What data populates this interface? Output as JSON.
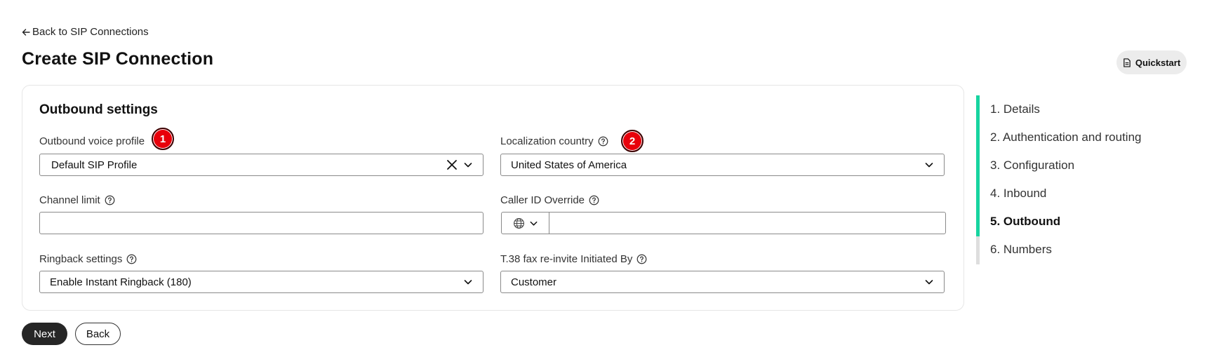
{
  "nav": {
    "back_label": "Back to SIP Connections"
  },
  "page": {
    "title": "Create SIP Connection",
    "quickstart_label": "Quickstart"
  },
  "section": {
    "title": "Outbound settings"
  },
  "fields": {
    "outbound_voice_profile": {
      "label": "Outbound voice profile",
      "value": "Default SIP Profile"
    },
    "localization_country": {
      "label": "Localization country",
      "value": "United States of America"
    },
    "channel_limit": {
      "label": "Channel limit",
      "value": "",
      "placeholder": ""
    },
    "caller_id_override": {
      "label": "Caller ID Override",
      "value": "",
      "placeholder": ""
    },
    "ringback_settings": {
      "label": "Ringback settings",
      "value": "Enable Instant Ringback (180)"
    },
    "t38_fax": {
      "label": "T.38 fax re-invite Initiated By",
      "value": "Customer"
    }
  },
  "markers": [
    "1",
    "2"
  ],
  "buttons": {
    "next": "Next",
    "back": "Back"
  },
  "steps": [
    {
      "label": "1. Details"
    },
    {
      "label": "2. Authentication and routing"
    },
    {
      "label": "3. Configuration"
    },
    {
      "label": "4. Inbound"
    },
    {
      "label": "5. Outbound"
    },
    {
      "label": "6. Numbers"
    }
  ],
  "current_step_index": 4,
  "colors": {
    "step_accent": "#17d4a0",
    "marker": "#e8000b",
    "primary_button": "#262626"
  },
  "icons": [
    "arrow-left-icon",
    "document-icon",
    "help-icon",
    "clear-icon",
    "chevron-down-icon",
    "globe-icon"
  ]
}
